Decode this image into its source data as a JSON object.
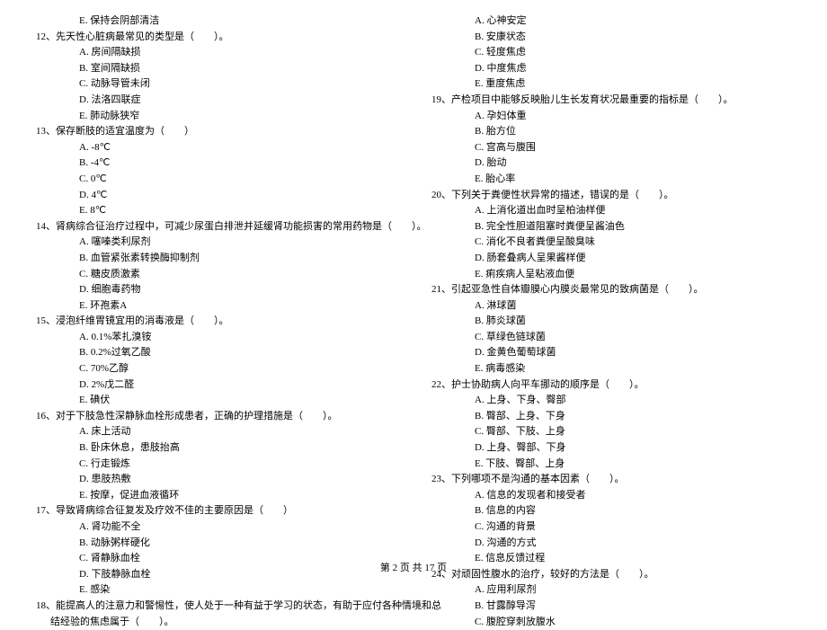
{
  "footer": "第 2 页 共 17 页",
  "left_column": [
    {
      "type": "option",
      "letter": "E.",
      "text": "保持会阴部清洁"
    },
    {
      "type": "question",
      "num": "12、",
      "text": "先天性心脏病最常见的类型是（　　）。"
    },
    {
      "type": "option",
      "letter": "A.",
      "text": "房间隔缺损"
    },
    {
      "type": "option",
      "letter": "B.",
      "text": "室间隔缺损"
    },
    {
      "type": "option",
      "letter": "C.",
      "text": "动脉导管未闭"
    },
    {
      "type": "option",
      "letter": "D.",
      "text": "法洛四联症"
    },
    {
      "type": "option",
      "letter": "E.",
      "text": "肺动脉狭窄"
    },
    {
      "type": "question",
      "num": "13、",
      "text": "保存断肢的适宜温度为（　　）"
    },
    {
      "type": "option",
      "letter": "A.",
      "text": "-8℃"
    },
    {
      "type": "option",
      "letter": "B.",
      "text": "-4℃"
    },
    {
      "type": "option",
      "letter": "C.",
      "text": "0℃"
    },
    {
      "type": "option",
      "letter": "D.",
      "text": "4℃"
    },
    {
      "type": "option",
      "letter": "E.",
      "text": "8℃"
    },
    {
      "type": "question",
      "num": "14、",
      "text": "肾病综合征治疗过程中，可减少尿蛋白排泄并延缓肾功能损害的常用药物是（　　）。"
    },
    {
      "type": "option",
      "letter": "A.",
      "text": "噻嗪类利尿剂"
    },
    {
      "type": "option",
      "letter": "B.",
      "text": "血管紧张素转换酶抑制剂"
    },
    {
      "type": "option",
      "letter": "C.",
      "text": "糖皮质激素"
    },
    {
      "type": "option",
      "letter": "D.",
      "text": "细胞毒药物"
    },
    {
      "type": "option",
      "letter": "E.",
      "text": "环孢素A"
    },
    {
      "type": "question",
      "num": "15、",
      "text": "浸泡纤维胃镜宜用的消毒液是（　　）。"
    },
    {
      "type": "option",
      "letter": "A.",
      "text": "0.1%苯扎溴铵"
    },
    {
      "type": "option",
      "letter": "B.",
      "text": "0.2%过氧乙酸"
    },
    {
      "type": "option",
      "letter": "C.",
      "text": "70%乙醇"
    },
    {
      "type": "option",
      "letter": "D.",
      "text": "2%戊二醛"
    },
    {
      "type": "option",
      "letter": "E.",
      "text": "碘伏"
    },
    {
      "type": "question",
      "num": "16、",
      "text": "对于下肢急性深静脉血栓形成患者，正确的护理措施是（　　）。"
    },
    {
      "type": "option",
      "letter": "A.",
      "text": "床上活动"
    },
    {
      "type": "option",
      "letter": "B.",
      "text": "卧床休息，患肢抬高"
    },
    {
      "type": "option",
      "letter": "C.",
      "text": "行走锻炼"
    },
    {
      "type": "option",
      "letter": "D.",
      "text": "患肢热敷"
    },
    {
      "type": "option",
      "letter": "E.",
      "text": "按摩，促进血液循环"
    },
    {
      "type": "question",
      "num": "17、",
      "text": "导致肾病综合征复发及疗效不佳的主要原因是（　　）"
    },
    {
      "type": "option",
      "letter": "A.",
      "text": "肾功能不全"
    },
    {
      "type": "option",
      "letter": "B.",
      "text": "动脉粥样硬化"
    },
    {
      "type": "option",
      "letter": "C.",
      "text": "肾静脉血栓"
    },
    {
      "type": "option",
      "letter": "D.",
      "text": "下肢静脉血栓"
    },
    {
      "type": "option",
      "letter": "E.",
      "text": "感染"
    },
    {
      "type": "question",
      "num": "18、",
      "text": "能提高人的注意力和警惕性，使人处于一种有益于学习的状态，有助于应付各种情境和总"
    },
    {
      "type": "continuation",
      "text": "结经验的焦虑属于（　　）。"
    }
  ],
  "right_column": [
    {
      "type": "option",
      "letter": "A.",
      "text": "心神安定"
    },
    {
      "type": "option",
      "letter": "B.",
      "text": "安康状态"
    },
    {
      "type": "option",
      "letter": "C.",
      "text": "轻度焦虑"
    },
    {
      "type": "option",
      "letter": "D.",
      "text": "中度焦虑"
    },
    {
      "type": "option",
      "letter": "E.",
      "text": "重度焦虑"
    },
    {
      "type": "question",
      "num": "19、",
      "text": "产检项目中能够反映胎儿生长发育状况最重要的指标是（　　）。"
    },
    {
      "type": "option",
      "letter": "A.",
      "text": "孕妇体重"
    },
    {
      "type": "option",
      "letter": "B.",
      "text": "胎方位"
    },
    {
      "type": "option",
      "letter": "C.",
      "text": "宫高与腹围"
    },
    {
      "type": "option",
      "letter": "D.",
      "text": "胎动"
    },
    {
      "type": "option",
      "letter": "E.",
      "text": "胎心率"
    },
    {
      "type": "question",
      "num": "20、",
      "text": "下列关于粪便性状异常的描述，错误的是（　　）。"
    },
    {
      "type": "option",
      "letter": "A.",
      "text": "上消化道出血时呈柏油样便"
    },
    {
      "type": "option",
      "letter": "B.",
      "text": "完全性胆道阻塞时粪便呈酱油色"
    },
    {
      "type": "option",
      "letter": "C.",
      "text": "消化不良者粪便呈酸臭味"
    },
    {
      "type": "option",
      "letter": "D.",
      "text": "肠套叠病人呈果酱样便"
    },
    {
      "type": "option",
      "letter": "E.",
      "text": "痢疾病人呈粘液血便"
    },
    {
      "type": "question",
      "num": "21、",
      "text": "引起亚急性自体瓣膜心内膜炎最常见的致病菌是（　　）。"
    },
    {
      "type": "option",
      "letter": "A.",
      "text": "淋球菌"
    },
    {
      "type": "option",
      "letter": "B.",
      "text": "肺炎球菌"
    },
    {
      "type": "option",
      "letter": "C.",
      "text": "草绿色链球菌"
    },
    {
      "type": "option",
      "letter": "D.",
      "text": "金黄色葡萄球菌"
    },
    {
      "type": "option",
      "letter": "E.",
      "text": "病毒感染"
    },
    {
      "type": "question",
      "num": "22、",
      "text": "护士协助病人向平车挪动的顺序是（　　）。"
    },
    {
      "type": "option",
      "letter": "A.",
      "text": "上身、下身、臀部"
    },
    {
      "type": "option",
      "letter": "B.",
      "text": "臀部、上身、下身"
    },
    {
      "type": "option",
      "letter": "C.",
      "text": "臀部、下肢、上身"
    },
    {
      "type": "option",
      "letter": "D.",
      "text": "上身、臀部、下身"
    },
    {
      "type": "option",
      "letter": "E.",
      "text": "下肢、臀部、上身"
    },
    {
      "type": "question",
      "num": "23、",
      "text": "下列哪项不是沟通的基本因素（　　）。"
    },
    {
      "type": "option",
      "letter": "A.",
      "text": "信息的发现者和接受者"
    },
    {
      "type": "option",
      "letter": "B.",
      "text": "信息的内容"
    },
    {
      "type": "option",
      "letter": "C.",
      "text": "沟通的背景"
    },
    {
      "type": "option",
      "letter": "D.",
      "text": "沟通的方式"
    },
    {
      "type": "option",
      "letter": "E.",
      "text": "信息反馈过程"
    },
    {
      "type": "question",
      "num": "24、",
      "text": "对顽固性腹水的治疗，较好的方法是（　　）。"
    },
    {
      "type": "option",
      "letter": "A.",
      "text": "应用利尿剂"
    },
    {
      "type": "option",
      "letter": "B.",
      "text": "甘露醇导泻"
    },
    {
      "type": "option",
      "letter": "C.",
      "text": "腹腔穿刺放腹水"
    }
  ]
}
